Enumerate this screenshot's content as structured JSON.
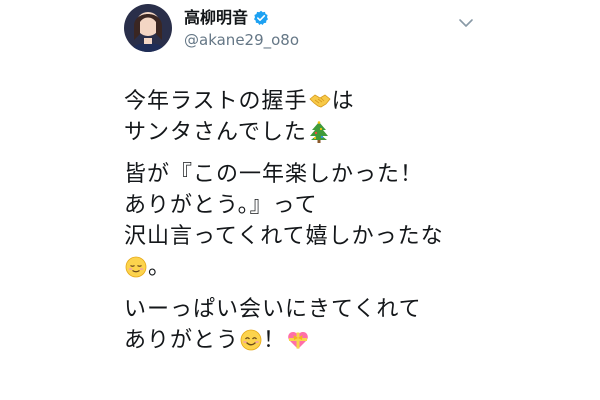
{
  "user": {
    "display_name": "高柳明音",
    "handle": "@akane29_o8o"
  },
  "tweet": {
    "p1": {
      "l1_a": "今年ラストの握手",
      "l1_b": "は",
      "l2": "サンタさんでした"
    },
    "p2": {
      "l1": "皆が『この一年楽しかった！",
      "l2": "ありがとう。』って",
      "l3": "沢山言ってくれて嬉しかったな",
      "l4": "。"
    },
    "p3": {
      "l1": "いーっぱい会いにきてくれて",
      "l2_a": "ありがとう",
      "l2_b": "！"
    }
  },
  "icons": {
    "avatar": "user-avatar",
    "verified": "verified-badge-icon",
    "caret": "chevron-down-icon",
    "e1": "handshake-emoji",
    "e2": "christmas-tree-emoji",
    "e3": "relieved-face-emoji",
    "e4": "smiling-face-emoji",
    "e5": "heart-with-ribbon-emoji"
  },
  "colors": {
    "verified_blue": "#1da1f2",
    "handle_gray": "#657786",
    "text": "#14171a"
  }
}
